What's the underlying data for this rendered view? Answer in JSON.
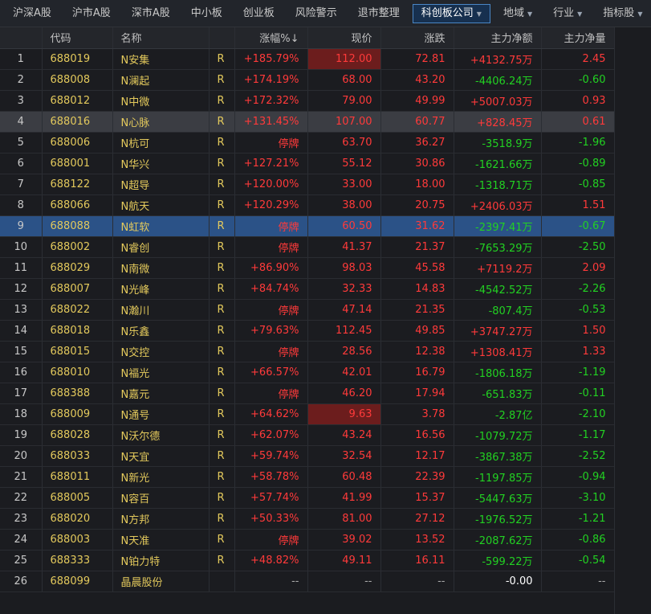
{
  "tabs": [
    {
      "label": "沪深A股",
      "dropdown": false,
      "active": false
    },
    {
      "label": "沪市A股",
      "dropdown": false,
      "active": false
    },
    {
      "label": "深市A股",
      "dropdown": false,
      "active": false
    },
    {
      "label": "中小板",
      "dropdown": false,
      "active": false
    },
    {
      "label": "创业板",
      "dropdown": false,
      "active": false
    },
    {
      "label": "风险警示",
      "dropdown": false,
      "active": false
    },
    {
      "label": "退市整理",
      "dropdown": false,
      "active": false
    },
    {
      "label": "科创板公司",
      "dropdown": true,
      "active": true
    },
    {
      "label": "地域",
      "dropdown": true,
      "active": false
    },
    {
      "label": "行业",
      "dropdown": true,
      "active": false
    },
    {
      "label": "指标股",
      "dropdown": true,
      "active": false
    }
  ],
  "columns": {
    "index": "",
    "code": "代码",
    "name": "名称",
    "flag": "",
    "change_pct": "涨幅%↓",
    "price": "现价",
    "change": "涨跌",
    "net_amount": "主力净额",
    "net_qty": "主力净量"
  },
  "colors": {
    "up": "#ff3a3a",
    "down": "#22d122",
    "selected": "#2b5287",
    "flash": "#6c1d1d"
  },
  "rows": [
    {
      "idx": "1",
      "code": "688019",
      "name": "N安集",
      "flag": "R",
      "pct": "+185.79%",
      "price": "112.00",
      "chg": "72.81",
      "amt": "+4132.75万",
      "qty": "2.45",
      "pct_c": "red",
      "price_c": "red",
      "chg_c": "red",
      "amt_c": "red",
      "qty_c": "red",
      "state": "",
      "flash": true
    },
    {
      "idx": "2",
      "code": "688008",
      "name": "N澜起",
      "flag": "R",
      "pct": "+174.19%",
      "price": "68.00",
      "chg": "43.20",
      "amt": "-4406.24万",
      "qty": "-0.60",
      "pct_c": "red",
      "price_c": "red",
      "chg_c": "red",
      "amt_c": "green",
      "qty_c": "green",
      "state": "",
      "flash": false
    },
    {
      "idx": "3",
      "code": "688012",
      "name": "N中微",
      "flag": "R",
      "pct": "+172.32%",
      "price": "79.00",
      "chg": "49.99",
      "amt": "+5007.03万",
      "qty": "0.93",
      "pct_c": "red",
      "price_c": "red",
      "chg_c": "red",
      "amt_c": "red",
      "qty_c": "red",
      "state": "",
      "flash": false
    },
    {
      "idx": "4",
      "code": "688016",
      "name": "N心脉",
      "flag": "R",
      "pct": "+131.45%",
      "price": "107.00",
      "chg": "60.77",
      "amt": "+828.45万",
      "qty": "0.61",
      "pct_c": "red",
      "price_c": "red",
      "chg_c": "red",
      "amt_c": "red",
      "qty_c": "red",
      "state": "highlight",
      "flash": false
    },
    {
      "idx": "5",
      "code": "688006",
      "name": "N杭可",
      "flag": "R",
      "pct": "停牌",
      "price": "63.70",
      "chg": "36.27",
      "amt": "-3518.9万",
      "qty": "-1.96",
      "pct_c": "red",
      "price_c": "red",
      "chg_c": "red",
      "amt_c": "green",
      "qty_c": "green",
      "state": "",
      "flash": false
    },
    {
      "idx": "6",
      "code": "688001",
      "name": "N华兴",
      "flag": "R",
      "pct": "+127.21%",
      "price": "55.12",
      "chg": "30.86",
      "amt": "-1621.66万",
      "qty": "-0.89",
      "pct_c": "red",
      "price_c": "red",
      "chg_c": "red",
      "amt_c": "green",
      "qty_c": "green",
      "state": "",
      "flash": false
    },
    {
      "idx": "7",
      "code": "688122",
      "name": "N超导",
      "flag": "R",
      "pct": "+120.00%",
      "price": "33.00",
      "chg": "18.00",
      "amt": "-1318.71万",
      "qty": "-0.85",
      "pct_c": "red",
      "price_c": "red",
      "chg_c": "red",
      "amt_c": "green",
      "qty_c": "green",
      "state": "",
      "flash": false
    },
    {
      "idx": "8",
      "code": "688066",
      "name": "N航天",
      "flag": "R",
      "pct": "+120.29%",
      "price": "38.00",
      "chg": "20.75",
      "amt": "+2406.03万",
      "qty": "1.51",
      "pct_c": "red",
      "price_c": "red",
      "chg_c": "red",
      "amt_c": "red",
      "qty_c": "red",
      "state": "",
      "flash": false
    },
    {
      "idx": "9",
      "code": "688088",
      "name": "N虹软",
      "flag": "R",
      "pct": "停牌",
      "price": "60.50",
      "chg": "31.62",
      "amt": "-2397.41万",
      "qty": "-0.67",
      "pct_c": "red",
      "price_c": "red",
      "chg_c": "red",
      "amt_c": "green",
      "qty_c": "green",
      "state": "selected",
      "flash": false
    },
    {
      "idx": "10",
      "code": "688002",
      "name": "N睿创",
      "flag": "R",
      "pct": "停牌",
      "price": "41.37",
      "chg": "21.37",
      "amt": "-7653.29万",
      "qty": "-2.50",
      "pct_c": "red",
      "price_c": "red",
      "chg_c": "red",
      "amt_c": "green",
      "qty_c": "green",
      "state": "",
      "flash": false
    },
    {
      "idx": "11",
      "code": "688029",
      "name": "N南微",
      "flag": "R",
      "pct": "+86.90%",
      "price": "98.03",
      "chg": "45.58",
      "amt": "+7119.2万",
      "qty": "2.09",
      "pct_c": "red",
      "price_c": "red",
      "chg_c": "red",
      "amt_c": "red",
      "qty_c": "red",
      "state": "",
      "flash": false
    },
    {
      "idx": "12",
      "code": "688007",
      "name": "N光峰",
      "flag": "R",
      "pct": "+84.74%",
      "price": "32.33",
      "chg": "14.83",
      "amt": "-4542.52万",
      "qty": "-2.26",
      "pct_c": "red",
      "price_c": "red",
      "chg_c": "red",
      "amt_c": "green",
      "qty_c": "green",
      "state": "",
      "flash": false
    },
    {
      "idx": "13",
      "code": "688022",
      "name": "N瀚川",
      "flag": "R",
      "pct": "停牌",
      "price": "47.14",
      "chg": "21.35",
      "amt": "-807.4万",
      "qty": "-0.53",
      "pct_c": "red",
      "price_c": "red",
      "chg_c": "red",
      "amt_c": "green",
      "qty_c": "green",
      "state": "",
      "flash": false
    },
    {
      "idx": "14",
      "code": "688018",
      "name": "N乐鑫",
      "flag": "R",
      "pct": "+79.63%",
      "price": "112.45",
      "chg": "49.85",
      "amt": "+3747.27万",
      "qty": "1.50",
      "pct_c": "red",
      "price_c": "red",
      "chg_c": "red",
      "amt_c": "red",
      "qty_c": "red",
      "state": "",
      "flash": false
    },
    {
      "idx": "15",
      "code": "688015",
      "name": "N交控",
      "flag": "R",
      "pct": "停牌",
      "price": "28.56",
      "chg": "12.38",
      "amt": "+1308.41万",
      "qty": "1.33",
      "pct_c": "red",
      "price_c": "red",
      "chg_c": "red",
      "amt_c": "red",
      "qty_c": "red",
      "state": "",
      "flash": false
    },
    {
      "idx": "16",
      "code": "688010",
      "name": "N福光",
      "flag": "R",
      "pct": "+66.57%",
      "price": "42.01",
      "chg": "16.79",
      "amt": "-1806.18万",
      "qty": "-1.19",
      "pct_c": "red",
      "price_c": "red",
      "chg_c": "red",
      "amt_c": "green",
      "qty_c": "green",
      "state": "",
      "flash": false
    },
    {
      "idx": "17",
      "code": "688388",
      "name": "N嘉元",
      "flag": "R",
      "pct": "停牌",
      "price": "46.20",
      "chg": "17.94",
      "amt": "-651.83万",
      "qty": "-0.11",
      "pct_c": "red",
      "price_c": "red",
      "chg_c": "red",
      "amt_c": "green",
      "qty_c": "green",
      "state": "",
      "flash": false
    },
    {
      "idx": "18",
      "code": "688009",
      "name": "N通号",
      "flag": "R",
      "pct": "+64.62%",
      "price": "9.63",
      "chg": "3.78",
      "amt": "-2.87亿",
      "qty": "-2.10",
      "pct_c": "red",
      "price_c": "red",
      "chg_c": "red",
      "amt_c": "green",
      "qty_c": "green",
      "state": "",
      "flash": true
    },
    {
      "idx": "19",
      "code": "688028",
      "name": "N沃尔德",
      "flag": "R",
      "pct": "+62.07%",
      "price": "43.24",
      "chg": "16.56",
      "amt": "-1079.72万",
      "qty": "-1.17",
      "pct_c": "red",
      "price_c": "red",
      "chg_c": "red",
      "amt_c": "green",
      "qty_c": "green",
      "state": "",
      "flash": false
    },
    {
      "idx": "20",
      "code": "688033",
      "name": "N天宜",
      "flag": "R",
      "pct": "+59.74%",
      "price": "32.54",
      "chg": "12.17",
      "amt": "-3867.38万",
      "qty": "-2.52",
      "pct_c": "red",
      "price_c": "red",
      "chg_c": "red",
      "amt_c": "green",
      "qty_c": "green",
      "state": "",
      "flash": false
    },
    {
      "idx": "21",
      "code": "688011",
      "name": "N新光",
      "flag": "R",
      "pct": "+58.78%",
      "price": "60.48",
      "chg": "22.39",
      "amt": "-1197.85万",
      "qty": "-0.94",
      "pct_c": "red",
      "price_c": "red",
      "chg_c": "red",
      "amt_c": "green",
      "qty_c": "green",
      "state": "",
      "flash": false
    },
    {
      "idx": "22",
      "code": "688005",
      "name": "N容百",
      "flag": "R",
      "pct": "+57.74%",
      "price": "41.99",
      "chg": "15.37",
      "amt": "-5447.63万",
      "qty": "-3.10",
      "pct_c": "red",
      "price_c": "red",
      "chg_c": "red",
      "amt_c": "green",
      "qty_c": "green",
      "state": "",
      "flash": false
    },
    {
      "idx": "23",
      "code": "688020",
      "name": "N方邦",
      "flag": "R",
      "pct": "+50.33%",
      "price": "81.00",
      "chg": "27.12",
      "amt": "-1976.52万",
      "qty": "-1.21",
      "pct_c": "red",
      "price_c": "red",
      "chg_c": "red",
      "amt_c": "green",
      "qty_c": "green",
      "state": "",
      "flash": false
    },
    {
      "idx": "24",
      "code": "688003",
      "name": "N天准",
      "flag": "R",
      "pct": "停牌",
      "price": "39.02",
      "chg": "13.52",
      "amt": "-2087.62万",
      "qty": "-0.86",
      "pct_c": "red",
      "price_c": "red",
      "chg_c": "red",
      "amt_c": "green",
      "qty_c": "green",
      "state": "",
      "flash": false
    },
    {
      "idx": "25",
      "code": "688333",
      "name": "N铂力特",
      "flag": "R",
      "pct": "+48.82%",
      "price": "49.11",
      "chg": "16.11",
      "amt": "-599.22万",
      "qty": "-0.54",
      "pct_c": "red",
      "price_c": "red",
      "chg_c": "red",
      "amt_c": "green",
      "qty_c": "green",
      "state": "",
      "flash": false
    },
    {
      "idx": "26",
      "code": "688099",
      "name": "晶晨股份",
      "flag": "",
      "pct": "--",
      "price": "--",
      "chg": "--",
      "amt": "-0.00",
      "qty": "--",
      "pct_c": "gray",
      "price_c": "gray",
      "chg_c": "gray",
      "amt_c": "white",
      "qty_c": "gray",
      "state": "",
      "flash": false
    }
  ]
}
